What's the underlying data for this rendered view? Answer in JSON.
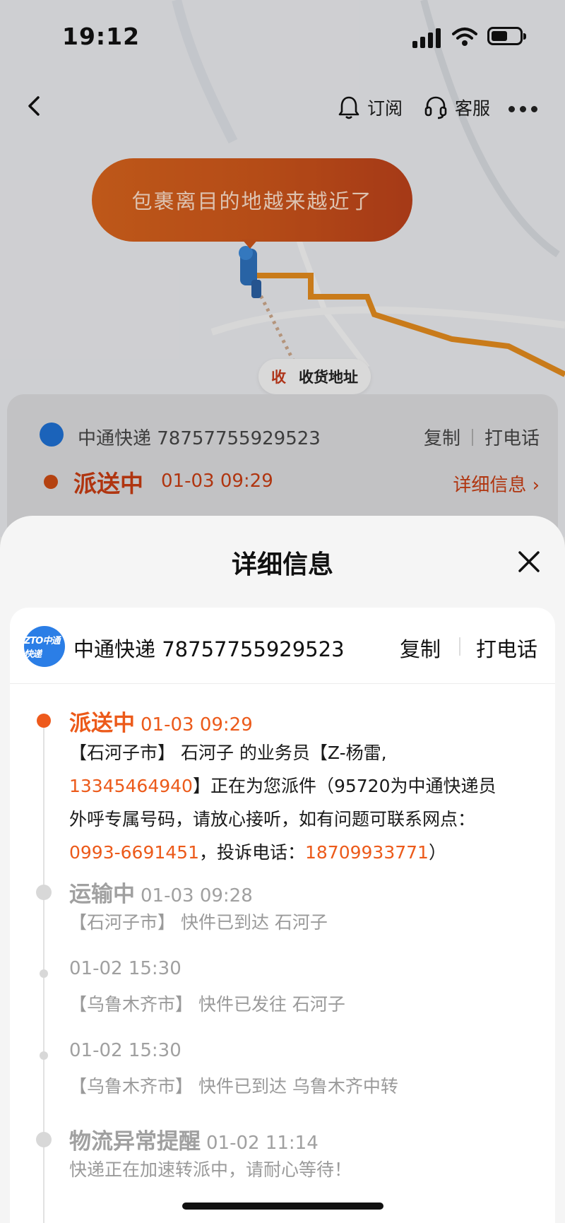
{
  "status_bar": {
    "time": "19:12"
  },
  "nav": {
    "subscribe_label": "订阅",
    "service_label": "客服"
  },
  "map": {
    "bubble_text": "包裹离目的地越来越近了",
    "address_tag": "收",
    "address_label": "收货地址",
    "route_color": "#e08a1e"
  },
  "background_card": {
    "carrier": "中通快递 78757755929523",
    "copy_label": "复制",
    "call_label": "打电话",
    "status": "派送中",
    "status_time": "01-03 09:29",
    "detail_link": "详细信息 ›"
  },
  "sheet": {
    "title": "详细信息",
    "carrier": {
      "logo_text": "ZTO中通快递",
      "text": "中通快递 78757755929523"
    },
    "copy_label": "复制",
    "call_label": "打电话"
  },
  "timeline": [
    {
      "status": "派送中",
      "time": "01-03 09:29",
      "line1": "【石河子市】 石河子 的业务员【Z-杨雷,",
      "phone": "13345464940",
      "line2_rest": "】正在为您派件（95720为中通快递员",
      "line3": "外呼专属号码，请放心接听，如有问题可联系网点：",
      "outlet_phone": "0993-6691451",
      "complaint_label": "，投诉电话：",
      "complaint_phone": "18709933771",
      "close_paren": "）"
    },
    {
      "status": "运输中",
      "time": "01-03 09:28",
      "desc": "【石河子市】 快件已到达 石河子"
    },
    {
      "time": "01-02 15:30",
      "desc": "【乌鲁木齐市】 快件已发往 石河子"
    },
    {
      "time": "01-02 15:30",
      "desc": "【乌鲁木齐市】 快件已到达 乌鲁木齐中转"
    },
    {
      "status": "物流异常提醒",
      "time": "01-02 11:14",
      "desc": "快递正在加速转派中，请耐心等待！"
    }
  ],
  "colors": {
    "accent": "#ec5a1a",
    "gray_text": "#a0a0a0",
    "logo_blue": "#2b7ee6"
  }
}
